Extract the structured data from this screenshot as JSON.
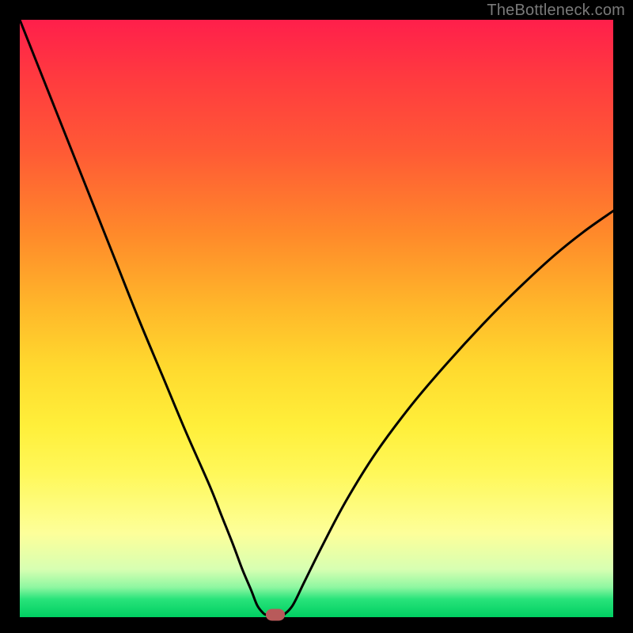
{
  "watermark": "TheBottleneck.com",
  "colors": {
    "frame": "#000000",
    "curve": "#000000",
    "marker": "#b85a5a",
    "gradient_top": "#ff1f4b",
    "gradient_bottom": "#00cf62"
  },
  "chart_data": {
    "type": "line",
    "title": "",
    "xlabel": "",
    "ylabel": "",
    "xlim": [
      0,
      100
    ],
    "ylim": [
      0,
      100
    ],
    "grid": false,
    "legend": false,
    "series": [
      {
        "name": "left-branch",
        "x": [
          0,
          4,
          8,
          12,
          16,
          20,
          24,
          28,
          32,
          34,
          36,
          37.5,
          39,
          40,
          41,
          41.5
        ],
        "values": [
          100,
          90,
          80,
          70,
          60,
          50,
          40.5,
          31,
          22,
          17,
          12,
          8,
          4.5,
          2,
          0.7,
          0.4
        ]
      },
      {
        "name": "right-branch",
        "x": [
          44.5,
          46,
          48,
          51,
          55,
          60,
          66,
          72,
          78,
          84,
          90,
          95,
          100
        ],
        "values": [
          0.4,
          2,
          6,
          12,
          19.5,
          27.5,
          35.5,
          42.5,
          49,
          55,
          60.5,
          64.5,
          68
        ]
      }
    ],
    "flat_bottom": {
      "x_start": 41.5,
      "x_end": 44.5,
      "y": 0.4
    },
    "marker": {
      "x": 43,
      "y": 0.4
    },
    "annotations": []
  }
}
